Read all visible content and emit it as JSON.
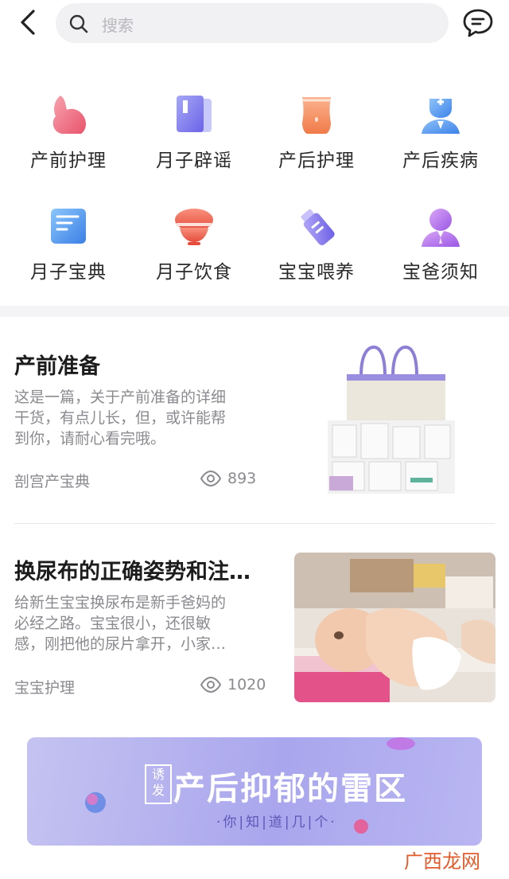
{
  "header": {
    "search_placeholder": "搜索"
  },
  "categories": [
    {
      "label": "产前护理",
      "icon": "belly-icon"
    },
    {
      "label": "月子辟谣",
      "icon": "book-icon"
    },
    {
      "label": "产后护理",
      "icon": "waist-icon"
    },
    {
      "label": "产后疾病",
      "icon": "doctor-icon"
    },
    {
      "label": "月子宝典",
      "icon": "document-icon"
    },
    {
      "label": "月子饮食",
      "icon": "bowl-icon"
    },
    {
      "label": "宝宝喂养",
      "icon": "bottle-icon"
    },
    {
      "label": "宝爸须知",
      "icon": "father-icon"
    }
  ],
  "articles": [
    {
      "title": "产前准备",
      "desc_lines": [
        "这是一篇，关于产前准备的详细",
        "干货，有点儿长，但，或许能帮",
        "到你，请耐心看完哦。"
      ],
      "source": "剖宫产宝典",
      "views": "893"
    },
    {
      "title": "换尿布的正确姿势和注…",
      "desc_lines": [
        "给新生宝宝换尿布是新手爸妈的",
        "必经之路。宝宝很小，还很敏",
        "感，刚把他的尿片拿开，小家…"
      ],
      "source": "宝宝护理",
      "views": "1020"
    }
  ],
  "banner": {
    "tag": "诱发",
    "title": "产后抑郁的雷区",
    "subtitle": "·你|知|道|几|个·"
  },
  "watermark": "广西龙网"
}
